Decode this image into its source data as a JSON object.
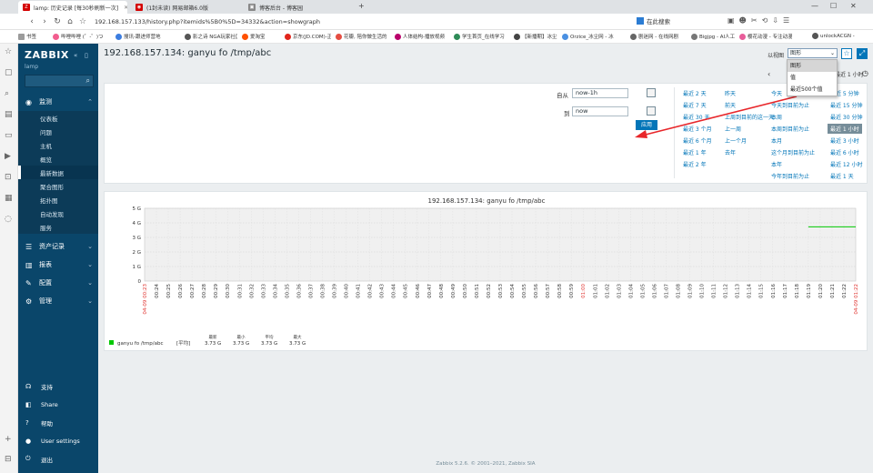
{
  "browser": {
    "tabs": [
      {
        "label": "lamp: 历史记录 [每30秒刷新一次]",
        "icon_color": "#d40000",
        "icon_char": "Z"
      },
      {
        "label": "(1封未读) 网易邮箱6.0版",
        "icon_color": "#d40000",
        "icon_char": "◉"
      },
      {
        "label": "博客后台 - 博客园",
        "icon_color": "#888888",
        "icon_char": "▣"
      }
    ],
    "new_tab": "+",
    "url": "192.168.157.133/history.php?itemids%5B0%5D=34332&action=showgraph",
    "search_label": "在此搜索",
    "bookmarks_label": "书签",
    "bookmarks": [
      {
        "label": "哔哩哔哩 (゜-゜)つ",
        "color": "#f25d8e"
      },
      {
        "label": "搜讯-跟进师营地",
        "color": "#3c7de0"
      },
      {
        "label": "影之诗 NGA玩家社区",
        "color": "#555555"
      },
      {
        "label": "爱淘宝",
        "color": "#ff5000"
      },
      {
        "label": "京东(JD.COM)-正品",
        "color": "#e1251b"
      },
      {
        "label": "花瓣, 陪你做生活的",
        "color": "#e54d42"
      },
      {
        "label": "人体结构-播放视频",
        "color": "#b9006b"
      },
      {
        "label": "学生首页_在线学习",
        "color": "#2e8b57"
      },
      {
        "label": "【新播期】冰尘识",
        "color": "#444444"
      },
      {
        "label": "Orzice_冰尘网 - 冰",
        "color": "#4a90e2"
      },
      {
        "label": "剧迷网 - 在线网剧",
        "color": "#666666"
      },
      {
        "label": "Bigjpg - AI人工智能",
        "color": "#777777"
      },
      {
        "label": "樱花动漫 - 专注动漫",
        "color": "#e85d9a"
      },
      {
        "label": "unlockACGN -",
        "color": "#555555"
      }
    ]
  },
  "sidebar": {
    "logo": "ZABBIX",
    "server": "lamp",
    "sections": [
      {
        "label": "监测",
        "icon": "eye-icon"
      },
      {
        "label": "资产记录",
        "icon": "list-icon"
      },
      {
        "label": "报表",
        "icon": "bar-chart-icon"
      },
      {
        "label": "配置",
        "icon": "wrench-icon"
      },
      {
        "label": "管理",
        "icon": "gear-icon"
      }
    ],
    "monitoring_items": [
      "仪表板",
      "问题",
      "主机",
      "概览",
      "最新数据",
      "聚合图形",
      "拓扑图",
      "自动发现",
      "服务"
    ],
    "footer_items": [
      "支持",
      "Share",
      "帮助",
      "User settings",
      "退出"
    ]
  },
  "page": {
    "title": "192.168.157.134: ganyu fo /tmp/abc",
    "view_as_label": "以视图",
    "view_as_value": "图形",
    "view_as_options": [
      "图形",
      "值",
      "最近500个值"
    ],
    "time_current": "最近 1 小时"
  },
  "filter": {
    "from_label": "自从",
    "from_value": "now-1h",
    "to_label": "到",
    "to_value": "now",
    "apply_label": "应用",
    "quick_ranges": {
      "col1": [
        "最近 2 天",
        "最近 7 天",
        "最近 30 天",
        "最近 3 个月",
        "最近 6 个月",
        "最近 1 年",
        "最近 2 年"
      ],
      "col2": [
        "昨天",
        "前天",
        "上周到目前的这一天",
        "上一周",
        "上一个月",
        "去年"
      ],
      "col3": [
        "今天",
        "今天到目前为止",
        "本周",
        "本周到目前为止",
        "本月",
        "这个月到目前为止",
        "本年",
        "今年到目前为止"
      ],
      "col4": [
        "最近 5 分钟",
        "最近 15 分钟",
        "最近 30 分钟",
        "最近 1 小时",
        "最近 3 小时",
        "最近 6 小时",
        "最近 12 小时",
        "最近 1 天"
      ]
    }
  },
  "chart_data": {
    "type": "line",
    "title": "192.168.157.134: ganyu fo /tmp/abc",
    "y_ticks": [
      "5 G",
      "4 G",
      "3 G",
      "2 G",
      "1 G",
      "0"
    ],
    "ylim": [
      0,
      5
    ],
    "x_labels": [
      "00:24",
      "00:25",
      "00:26",
      "00:27",
      "00:28",
      "00:29",
      "00:30",
      "00:31",
      "00:32",
      "00:33",
      "00:34",
      "00:35",
      "00:36",
      "00:37",
      "00:38",
      "00:39",
      "00:40",
      "00:41",
      "00:42",
      "00:43",
      "00:44",
      "00:45",
      "00:46",
      "00:47",
      "00:48",
      "00:49",
      "00:50",
      "00:51",
      "00:52",
      "00:53",
      "00:54",
      "00:55",
      "00:56",
      "00:57",
      "00:58",
      "00:59",
      "01:00",
      "01:01",
      "01:02",
      "01:03",
      "01:04",
      "01:05",
      "01:06",
      "01:07",
      "01:08",
      "01:09",
      "01:10",
      "01:11",
      "01:12",
      "01:13",
      "01:14",
      "01:15",
      "01:16",
      "01:17",
      "01:18",
      "01:19",
      "01:20",
      "01:21",
      "01:22"
    ],
    "x_start": "04-09 00:23",
    "x_end": "04-09 01:22",
    "highlight_label": "01:00",
    "series": [
      {
        "name": "ganyu fo /tmp/abc",
        "color": "#00c800",
        "x": [
          "01:19",
          "01:22"
        ],
        "y": [
          3.73,
          3.73
        ]
      }
    ],
    "legend": {
      "aggregation": "[平均]",
      "headers": [
        "最新",
        "最小",
        "平均",
        "最大"
      ],
      "values": [
        "3.73 G",
        "3.73 G",
        "3.73 G",
        "3.73 G"
      ]
    }
  },
  "footer": "Zabbix 5.2.6. © 2001–2021, Zabbix SIA"
}
